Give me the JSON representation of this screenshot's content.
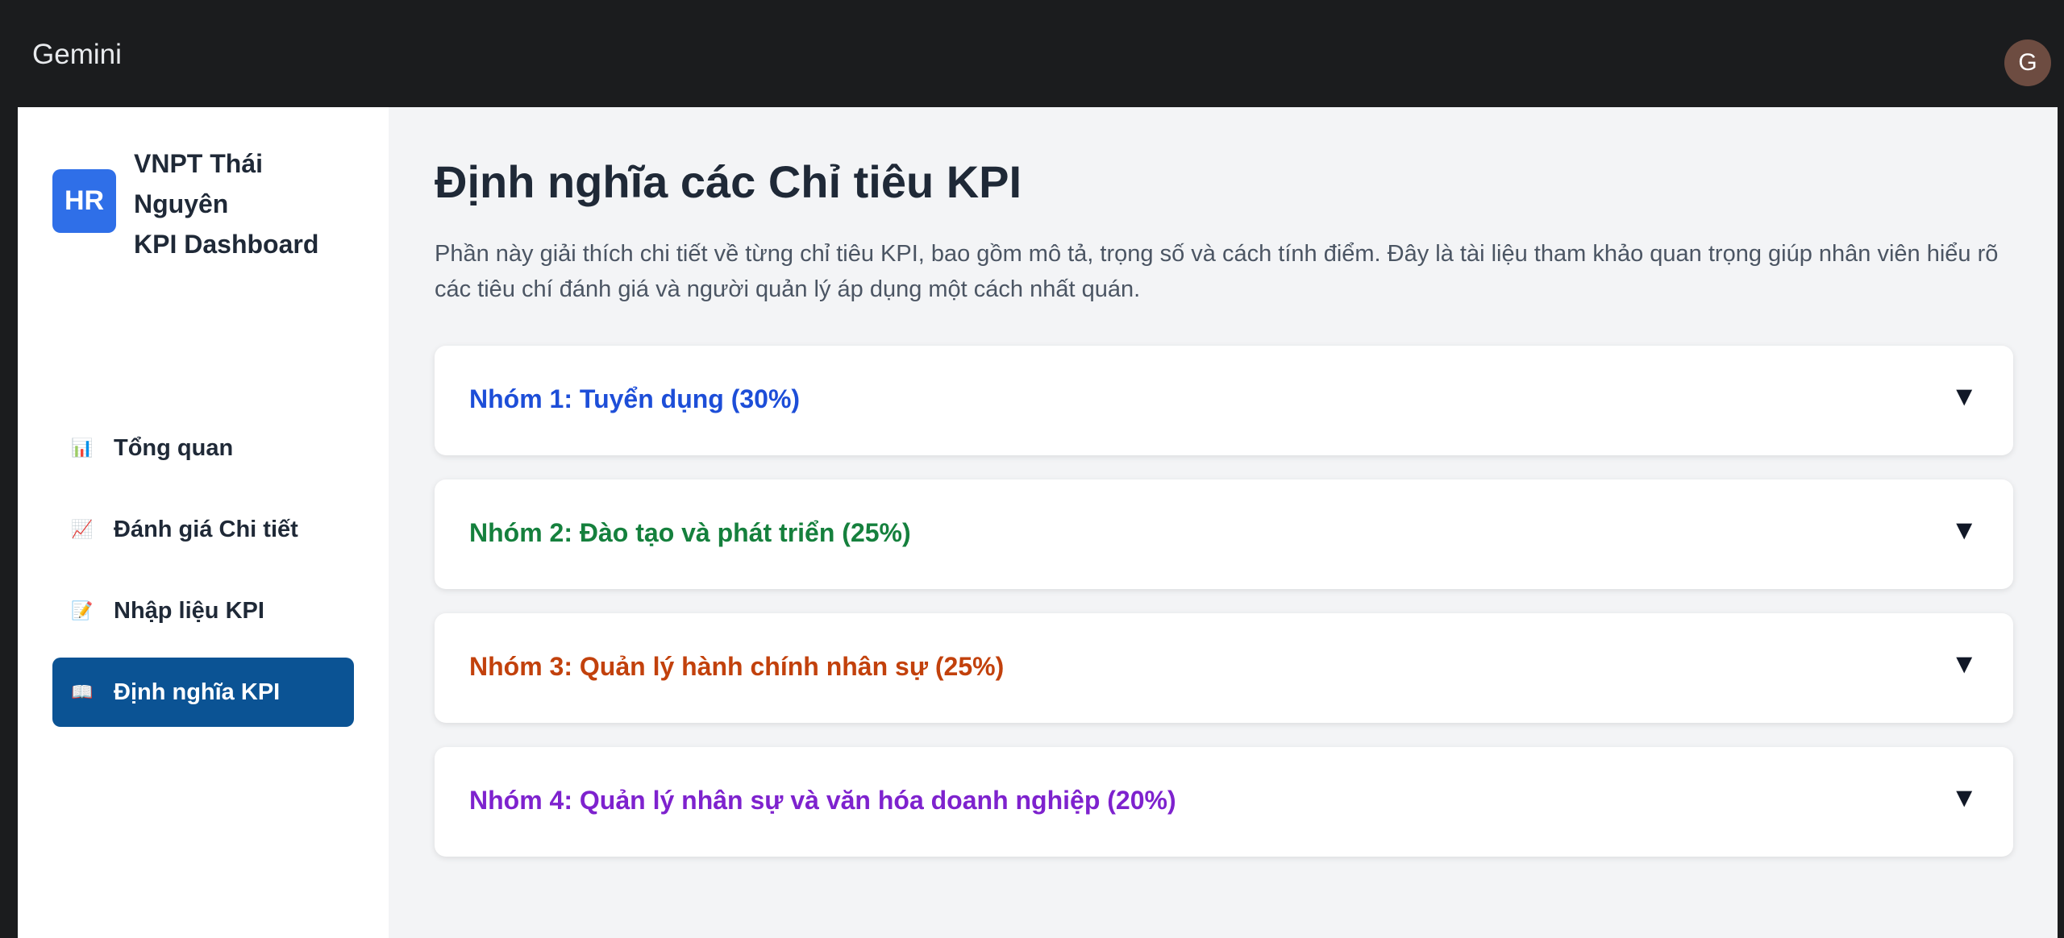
{
  "app": {
    "title": "Gemini",
    "user_initial": "G"
  },
  "sidebar": {
    "logo_text": "HR",
    "brand_lines": [
      "VNPT Thái",
      "Nguyên",
      "KPI Dashboard"
    ],
    "items": [
      {
        "icon": "📊",
        "icon_name": "bar-chart-icon",
        "label": "Tổng quan",
        "active": false
      },
      {
        "icon": "📈",
        "icon_name": "trend-chart-icon",
        "label": "Đánh giá Chi tiết",
        "active": false
      },
      {
        "icon": "📝",
        "icon_name": "memo-icon",
        "label": "Nhập liệu KPI",
        "active": false
      },
      {
        "icon": "📖",
        "icon_name": "book-icon",
        "label": "Định nghĩa KPI",
        "active": true
      }
    ],
    "active_color": "#0b5394"
  },
  "main": {
    "title": "Định nghĩa các Chỉ tiêu KPI",
    "description": "Phần này giải thích chi tiết về từng chỉ tiêu KPI, bao gồm mô tả, trọng số và cách tính điểm. Đây là tài liệu tham khảo quan trọng giúp nhân viên hiểu rõ các tiêu chí đánh giá và người quản lý áp dụng một cách nhất quán.",
    "groups": [
      {
        "label": "Nhóm 1: Tuyển dụng (30%)",
        "color": "#1d4ed8",
        "toggle": "▼"
      },
      {
        "label": "Nhóm 2: Đào tạo và phát triển (25%)",
        "color": "#15803d",
        "toggle": "▼"
      },
      {
        "label": "Nhóm 3: Quản lý hành chính nhân sự (25%)",
        "color": "#c2410c",
        "toggle": "▼"
      },
      {
        "label": "Nhóm 4: Quản lý nhân sự và văn hóa doanh nghiệp (20%)",
        "color": "#7e22ce",
        "toggle": "▼"
      }
    ]
  }
}
